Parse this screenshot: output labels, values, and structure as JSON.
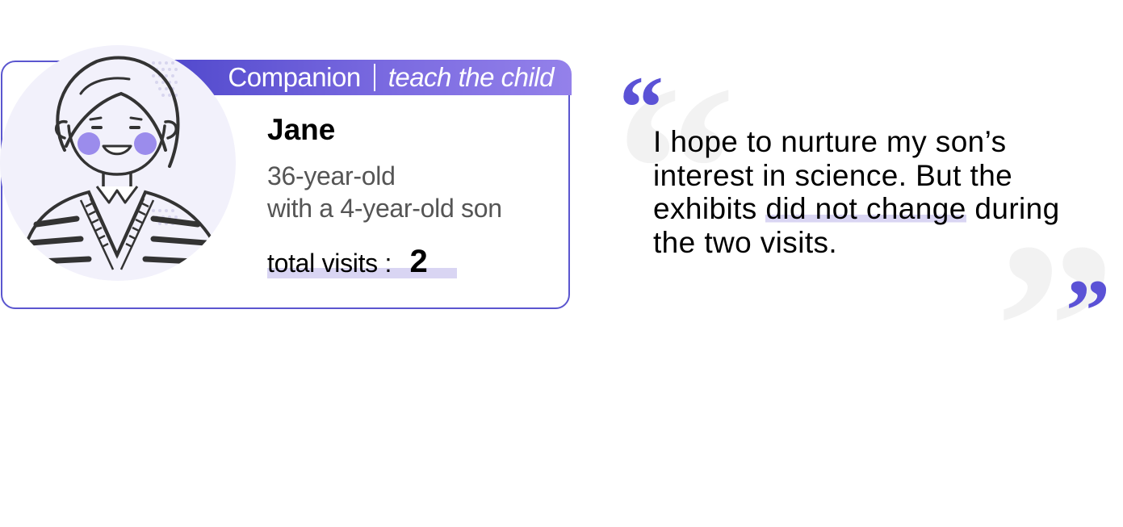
{
  "persona": {
    "role": "Companion",
    "motto": "teach the child",
    "name": "Jane",
    "age": "36-year-old",
    "family": "with a 4-year-old son",
    "visits_label": "total visits :",
    "visits_count": "2"
  },
  "quote": {
    "open_mark": "“",
    "close_mark": "”",
    "text_before": "I hope to nurture my son’s interest in science. But the exhibits ",
    "text_highlight": "did not change",
    "text_after": " during the two visits."
  },
  "colors": {
    "accent": "#5b52d6",
    "header_gradient_start": "#5048cc",
    "header_gradient_end": "#9481ea",
    "highlight": "#d9d5f3",
    "cheek": "#9b8cec"
  },
  "icons": {
    "avatar": "woman-illustration-icon"
  }
}
